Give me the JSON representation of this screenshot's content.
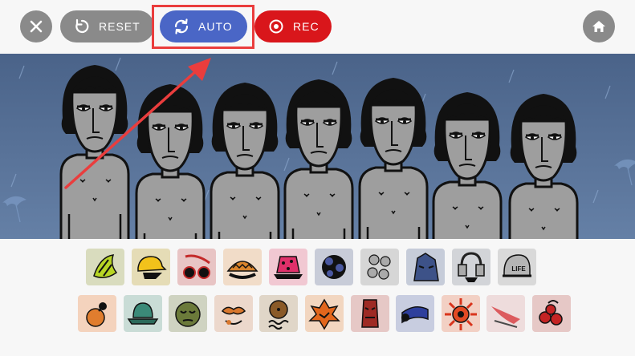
{
  "toolbar": {
    "close_icon": "close-icon",
    "reset_label": "RESET",
    "reset_icon": "reset-icon",
    "auto_label": "AUTO",
    "auto_icon": "refresh-icon",
    "rec_label": "REC",
    "rec_icon": "record-icon",
    "home_icon": "home-icon"
  },
  "colors": {
    "button_gray": "#8a8a8a",
    "auto_blue": "#4a66c6",
    "rec_red": "#d9161b",
    "annotation_red": "#ea3d3d",
    "stage_blue": "#536d93",
    "character_gray": "#9e9e9e"
  },
  "stage": {
    "character_count": 7
  },
  "palette": {
    "row1": [
      "bright-green-sound",
      "yellow-cap-sound",
      "red-sunglasses-sound",
      "orange-taco-hat-sound",
      "pink-bucket-hat-sound",
      "blue-black-mask-sound",
      "gray-circles-sound",
      "blue-mask-sound",
      "gray-headphones-sound",
      "life-helmet-sound"
    ],
    "row2": [
      "orange-bomb-sound",
      "teal-hat-sound",
      "olive-face-sound",
      "orange-mustache-sound",
      "brown-curl-sound",
      "orange-flame-sound",
      "red-mask-sound",
      "blue-scarf-sound",
      "sun-burst-sound",
      "red-wing-sound",
      "red-berries-sound"
    ],
    "row2_locked": [
      "red-wing-sound"
    ],
    "life_text": "LIFE"
  }
}
